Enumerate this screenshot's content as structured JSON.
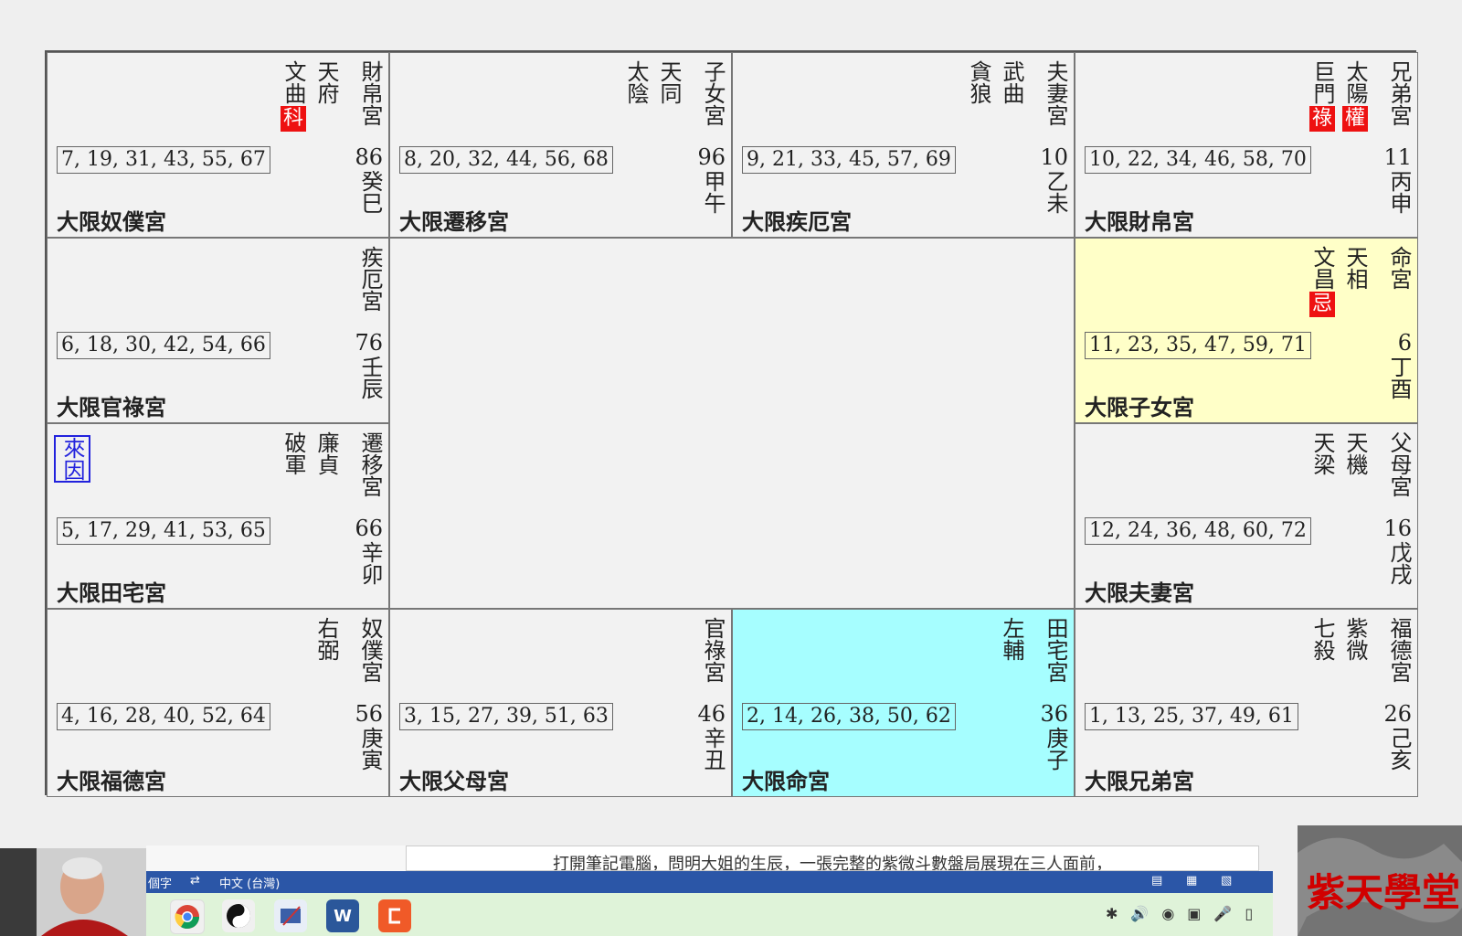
{
  "palaces": [
    {
      "id": "si",
      "name": "財帛宮",
      "stars": [
        {
          "name": "天府"
        },
        {
          "name": "文曲",
          "transform": "科"
        }
      ],
      "ages": "7, 19, 31, 43, 55, 67",
      "num": "86",
      "ganzhi": "癸巳",
      "decade": "大限奴僕宮"
    },
    {
      "id": "wu",
      "name": "子女宮",
      "stars": [
        {
          "name": "天同"
        },
        {
          "name": "太陰"
        }
      ],
      "ages": "8, 20, 32, 44, 56, 68",
      "num": "96",
      "ganzhi": "甲午",
      "decade": "大限遷移宮"
    },
    {
      "id": "wei",
      "name": "夫妻宮",
      "stars": [
        {
          "name": "武曲"
        },
        {
          "name": "貪狼"
        }
      ],
      "ages": "9, 21, 33, 45, 57, 69",
      "num": "10",
      "ganzhi": "乙未",
      "decade": "大限疾厄宮"
    },
    {
      "id": "shen",
      "name": "兄弟宮",
      "stars": [
        {
          "name": "太陽",
          "transform": "權"
        },
        {
          "name": "巨門",
          "transform": "祿"
        }
      ],
      "ages": "10, 22, 34, 46, 58, 70",
      "num": "11",
      "ganzhi": "丙申",
      "decade": "大限財帛宮"
    },
    {
      "id": "chen",
      "name": "疾厄宮",
      "stars": [],
      "ages": "6, 18, 30, 42, 54, 66",
      "num": "76",
      "ganzhi": "壬辰",
      "decade": "大限官祿宮"
    },
    {
      "id": "you",
      "name": "命宮",
      "stars": [
        {
          "name": "天相"
        },
        {
          "name": "文昌",
          "transform": "忌"
        }
      ],
      "ages": "11, 23, 35, 47, 59, 71",
      "num": "6",
      "ganzhi": "丁酉",
      "decade": "大限子女宮",
      "highlight": "yellow"
    },
    {
      "id": "mao",
      "name": "遷移宮",
      "stars": [
        {
          "name": "廉貞"
        },
        {
          "name": "破軍"
        }
      ],
      "ages": "5, 17, 29, 41, 53, 65",
      "num": "66",
      "ganzhi": "辛卯",
      "decade": "大限田宅宮",
      "marker": "來因"
    },
    {
      "id": "xu",
      "name": "父母宮",
      "stars": [
        {
          "name": "天機"
        },
        {
          "name": "天梁"
        }
      ],
      "ages": "12, 24, 36, 48, 60, 72",
      "num": "16",
      "ganzhi": "戊戌",
      "decade": "大限夫妻宮"
    },
    {
      "id": "yin",
      "name": "奴僕宮",
      "stars": [
        {
          "name": "右弼"
        }
      ],
      "ages": "4, 16, 28, 40, 52, 64",
      "num": "56",
      "ganzhi": "庚寅",
      "decade": "大限福德宮"
    },
    {
      "id": "chou",
      "name": "官祿宮",
      "stars": [],
      "ages": "3, 15, 27, 39, 51, 63",
      "num": "46",
      "ganzhi": "辛丑",
      "decade": "大限父母宮"
    },
    {
      "id": "zi",
      "name": "田宅宮",
      "stars": [
        {
          "name": "左輔"
        }
      ],
      "ages": "2, 14, 26, 38, 50, 62",
      "num": "36",
      "ganzhi": "庚子",
      "decade": "大限命宮",
      "highlight": "cyan"
    },
    {
      "id": "hai",
      "name": "福德宮",
      "stars": [
        {
          "name": "紫微"
        },
        {
          "name": "七殺"
        }
      ],
      "ages": "1, 13, 25, 37, 49, 61",
      "num": "26",
      "ganzhi": "己亥",
      "decade": "大限兄弟宮"
    }
  ],
  "colors": {
    "transform_badge": "#ee1111",
    "marker": "#2222dd",
    "highlight_yellow": "#ffffc8",
    "highlight_cyan": "#a6feff",
    "taskbar": "#2b56a7"
  },
  "document": {
    "caption": "打開筆記電腦，問明大姐的生辰，一張完整的紫微斗數盤局展現在三人面前，"
  },
  "ime_bar": {
    "left_label": "個字",
    "ime_icon": "ime-icon",
    "language": "中文 (台灣)"
  },
  "taskbar": {
    "apps": [
      "chrome-icon",
      "taiji-icon",
      "pen-tablet-icon",
      "word-icon",
      "capcut-icon"
    ],
    "word_letter": "W"
  },
  "watermark": {
    "text": "紫天學堂"
  }
}
